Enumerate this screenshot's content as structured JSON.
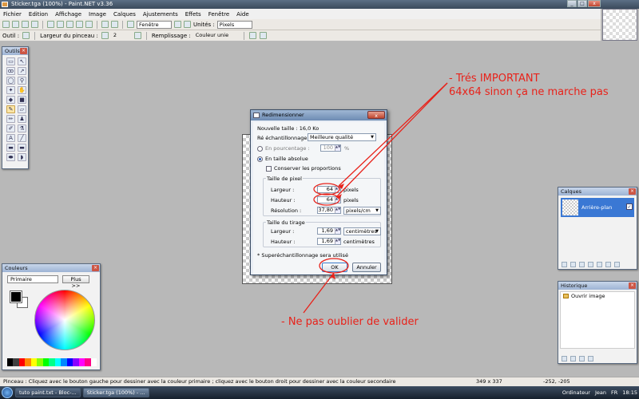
{
  "window": {
    "title": "Sticker.tga (100%) - Paint.NET v3.36",
    "minimize": "_",
    "maximize": "□",
    "close": "x"
  },
  "menu": [
    "Fichier",
    "Edition",
    "Affichage",
    "Image",
    "Calques",
    "Ajustements",
    "Effets",
    "Fenêtre",
    "Aide"
  ],
  "toolbar": {
    "window_select": "Fenêtre",
    "units_label": "Unités :",
    "units_value": "Pixels"
  },
  "options": {
    "tool_label": "Outil :",
    "brush_width_label": "Largeur du pinceau :",
    "brush_width_value": "2",
    "fill_label": "Remplissage :",
    "fill_value": "Couleur unie"
  },
  "tools_panel": {
    "title": "Outils"
  },
  "colors_panel": {
    "title": "Couleurs",
    "mode": "Primaire",
    "more_button": "Plus >>"
  },
  "layers_panel": {
    "title": "Calques",
    "layer_name": "Arrière-plan",
    "visible_mark": "✓"
  },
  "history_panel": {
    "title": "Historique",
    "items": [
      "Ouvrir image"
    ]
  },
  "dialog": {
    "title": "Redimensionner",
    "close_label": "x",
    "new_size": "Nouvelle taille : 16,0 Ko",
    "resampling_label": "Ré échantillonnage :",
    "resampling_value": "Meilleure qualité",
    "percent_label": "En pourcentage :",
    "percent_value": "100",
    "percent_unit": "%",
    "absolute_label": "En taille absolue",
    "keep_ratio_label": "Conserver les proportions",
    "pixel_size_group": "Taille de pixel",
    "width_label": "Largeur :",
    "width_value": "64",
    "width_unit": "pixels",
    "height_label": "Hauteur :",
    "height_value": "64",
    "height_unit": "pixels",
    "resolution_label": "Résolution :",
    "resolution_value": "37,80",
    "resolution_unit": "pixels/cm",
    "print_size_group": "Taille du tirage",
    "print_width_label": "Largeur :",
    "print_width_value": "1,69",
    "print_width_unit": "centimètres",
    "print_height_label": "Hauteur :",
    "print_height_value": "1,69",
    "print_height_unit": "centimètres",
    "footnote": "* Superéchantillonnage sera utilisé",
    "ok": "OK",
    "cancel": "Annuler"
  },
  "annotations": {
    "note1_line1": "- Trés IMPORTANT",
    "note1_line2": "64x64 sinon ça ne marche pas",
    "note2": "- Ne pas oublier de valider",
    "color": "#e8221a"
  },
  "status": {
    "message": "Pinceau : Cliquez avec le bouton gauche pour dessiner avec la couleur primaire ; cliquez avec le bouton droit pour dessiner avec la couleur secondaire",
    "image_size": "349 x 337",
    "cursor": "-252, -205"
  },
  "taskbar": {
    "tasks": [
      "tuto paint.txt - Bloc-...",
      "Sticker.tga (100%) - ..."
    ],
    "tray_computer": "Ordinateur",
    "tray_user": "Jean",
    "tray_lang": "FR",
    "clock": "18:15"
  }
}
